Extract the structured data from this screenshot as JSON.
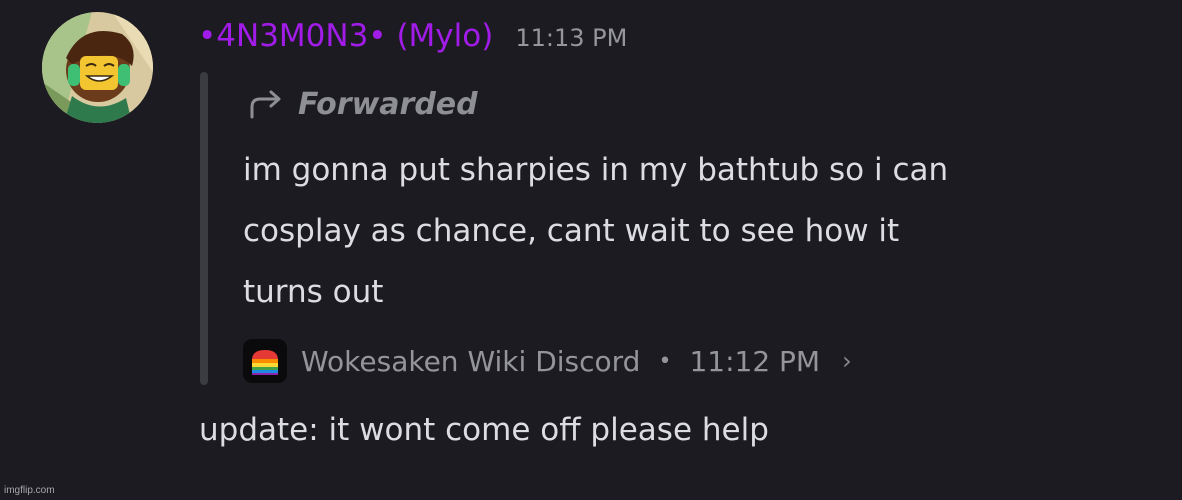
{
  "author": {
    "display_name": "•4N3M0N3•  (Mylo)",
    "name_color": "#a11ce8",
    "timestamp": "11:13 PM",
    "avatar_icon": "user-avatar"
  },
  "forwarded": {
    "label": "Forwarded",
    "icon": "forward-arrow-icon",
    "lines": [
      "im gonna put sharpies in my bathtub so i can",
      "cosplay as chance, cant wait to see how it",
      "turns out"
    ],
    "source": {
      "server_name": "Wokesaken Wiki Discord",
      "separator": "•",
      "time": "11:12 PM",
      "icon": "server-icon",
      "chevron": "›"
    }
  },
  "reply": {
    "text": "update: it wont come off please help"
  },
  "watermark": "imgflip.com",
  "colors": {
    "background": "#1c1b21",
    "text": "#dcdde1",
    "muted": "#95969c",
    "quote_bar": "#3b3c41"
  }
}
